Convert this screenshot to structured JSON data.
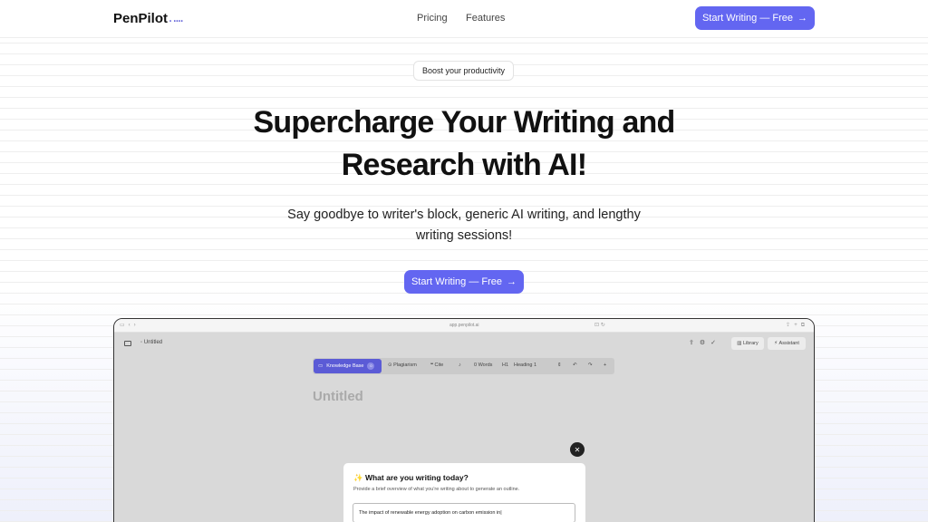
{
  "nav": {
    "logo": "PenPilot",
    "logo_dots": "• ••••",
    "links": [
      "Pricing",
      "Features"
    ],
    "cta": "Start Writing — Free"
  },
  "hero": {
    "badge": "Boost your productivity",
    "title_line1": "Supercharge Your Writing and",
    "title_line2": "Research with AI!",
    "subtitle_line1": "Say goodbye to writer's block, generic AI writing, and lengthy",
    "subtitle_line2": "writing sessions!",
    "cta": "Start Writing — Free"
  },
  "mockup": {
    "url": "app.penpilot.ai",
    "doc_tab": "Untitled",
    "library": "Library",
    "assistant": "Assistant",
    "editor_bar": {
      "knowledge_base": "Knowledge Base",
      "kb_count": "0",
      "plagiarism": "Plagiarism",
      "cite": "Cite",
      "words": "0 Words",
      "heading_tag": "H1",
      "heading": "Heading 1"
    },
    "doc_title": "Untitled",
    "dialog": {
      "title": "What are you writing today?",
      "subtitle": "Provide a brief overview of what you're writing about to generate an outline.",
      "input_value": "The impact of renewable energy adoption on carbon emission in"
    }
  },
  "colors": {
    "accent": "#6366f1"
  }
}
